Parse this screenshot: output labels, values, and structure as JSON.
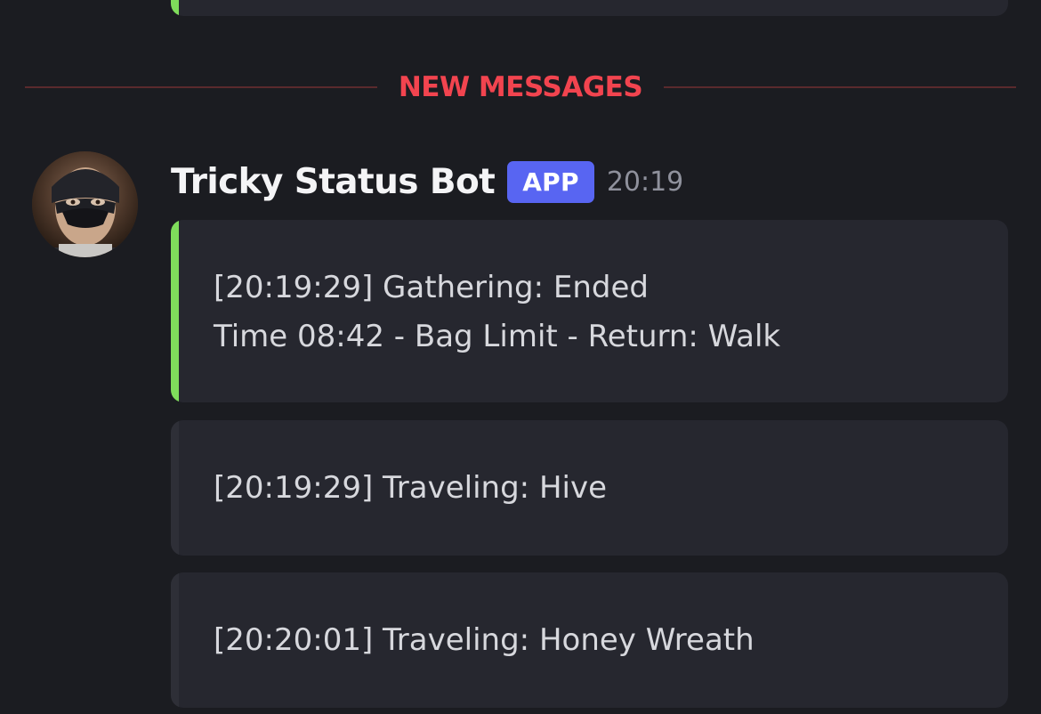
{
  "divider": {
    "label": "NEW MESSAGES"
  },
  "message": {
    "author": "Tricky Status Bot",
    "badge": "APP",
    "timestamp": "20:19",
    "avatar_icon": "masked-person-avatar",
    "embeds": [
      {
        "accent_color": "#7fdc5b",
        "lines": [
          "[20:19:29] Gathering: Ended",
          "Time 08:42 - Bag Limit - Return: Walk"
        ]
      },
      {
        "accent_color": "#2e2f37",
        "lines": [
          "[20:19:29] Traveling: Hive"
        ]
      },
      {
        "accent_color": "#2e2f37",
        "lines": [
          "[20:20:01] Traveling: Honey Wreath"
        ]
      }
    ]
  },
  "colors": {
    "background": "#1b1c21",
    "embed_background": "#26272f",
    "new_messages": "#f2444f",
    "app_badge": "#5865f2",
    "author_text": "#f4f4f6",
    "timestamp_text": "#8f919c"
  }
}
